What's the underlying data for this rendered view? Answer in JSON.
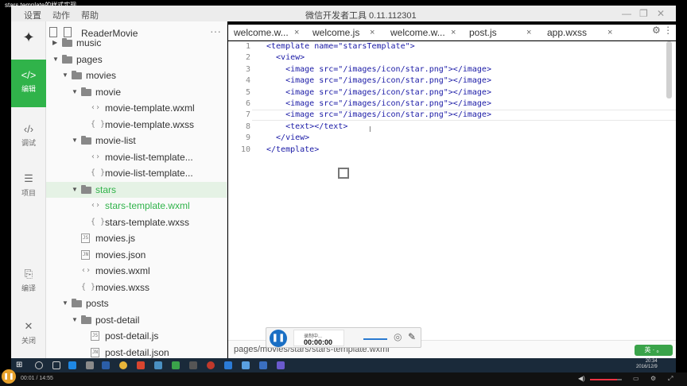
{
  "video_title": "stars template的样式实现",
  "menubar": {
    "menu_items": [
      "设置",
      "动作",
      "帮助"
    ],
    "app_title": "微信开发者工具 0.11.112301",
    "window_controls": [
      "minimize",
      "restore",
      "close"
    ]
  },
  "activity": {
    "items": [
      {
        "icon": "code-icon",
        "glyph": "</>",
        "label": "编辑"
      },
      {
        "icon": "debug-icon",
        "glyph": "‹/›",
        "label": "调试"
      },
      {
        "icon": "project-icon",
        "glyph": "☰",
        "label": "项目"
      },
      {
        "icon": "compile-icon",
        "glyph": "⎘",
        "label": "编译"
      },
      {
        "icon": "close-icon",
        "glyph": "✕",
        "label": "关闭"
      }
    ]
  },
  "tree": {
    "project_name": "ReaderMovie",
    "more": "···",
    "rows": [
      {
        "label": "music",
        "kind": "folder",
        "indent": 1,
        "expanded": false
      },
      {
        "label": "pages",
        "kind": "folder",
        "indent": 1,
        "expanded": true
      },
      {
        "label": "movies",
        "kind": "folder",
        "indent": 2,
        "expanded": true
      },
      {
        "label": "movie",
        "kind": "folder",
        "indent": 3,
        "expanded": true
      },
      {
        "label": "movie-template.wxml",
        "kind": "code",
        "indent": 4
      },
      {
        "label": "movie-template.wxss",
        "kind": "style",
        "indent": 4
      },
      {
        "label": "movie-list",
        "kind": "folder",
        "indent": 3,
        "expanded": true
      },
      {
        "label": "movie-list-template...",
        "kind": "code",
        "indent": 4
      },
      {
        "label": "movie-list-template...",
        "kind": "style",
        "indent": 4
      },
      {
        "label": "stars",
        "kind": "folder",
        "indent": 3,
        "expanded": true,
        "selected": true
      },
      {
        "label": "stars-template.wxml",
        "kind": "code",
        "indent": 4,
        "active": true
      },
      {
        "label": "stars-template.wxss",
        "kind": "style",
        "indent": 4
      },
      {
        "label": "movies.js",
        "kind": "js",
        "indent": 3
      },
      {
        "label": "movies.json",
        "kind": "json",
        "indent": 3
      },
      {
        "label": "movies.wxml",
        "kind": "code",
        "indent": 3
      },
      {
        "label": "movies.wxss",
        "kind": "style",
        "indent": 3
      },
      {
        "label": "posts",
        "kind": "folder",
        "indent": 2,
        "expanded": true
      },
      {
        "label": "post-detail",
        "kind": "folder",
        "indent": 3,
        "expanded": true
      },
      {
        "label": "post-detail.js",
        "kind": "js",
        "indent": 4
      },
      {
        "label": "post-detail.json",
        "kind": "json",
        "indent": 4
      }
    ]
  },
  "tabs": [
    {
      "label": "welcome.w...",
      "close": "×"
    },
    {
      "label": "welcome.js",
      "close": "×"
    },
    {
      "label": "welcome.w...",
      "close": "×"
    },
    {
      "label": "post.js",
      "close": "×"
    },
    {
      "label": "app.wxss",
      "close": "×"
    }
  ],
  "tabs_more": "⚙ ⋮",
  "editor": {
    "line_numbers": [
      "1",
      "2",
      "3",
      "4",
      "5",
      "6",
      "7",
      "8",
      "9",
      "10"
    ],
    "lines": [
      "<template name=\"starsTemplate\">",
      "  <view>",
      "    <image src=\"/images/icon/star.png\"></image>",
      "    <image src=\"/images/icon/star.png\"></image>",
      "    <image src=\"/images/icon/star.png\"></image>",
      "    <image src=\"/images/icon/star.png\"></image>",
      "    <image src=\"/images/icon/star.png\"></image>",
      "    <text></text>",
      "  </view>",
      "</template>"
    ]
  },
  "status": {
    "path": "pages/movies/stars/stars-template.wxml"
  },
  "recorder": {
    "status": "录制中...",
    "time": "00:00:00"
  },
  "badge": "英 · 。",
  "taskbar": {
    "clock_time": "20:34",
    "clock_date": "2016/12/9"
  },
  "player": {
    "time": "00:01 / 14:55",
    "volume_level": 0.85
  },
  "colors": {
    "accent_green": "#30b34a",
    "recorder_blue": "#1a6fc4",
    "player_orange": "#e8a12a"
  }
}
